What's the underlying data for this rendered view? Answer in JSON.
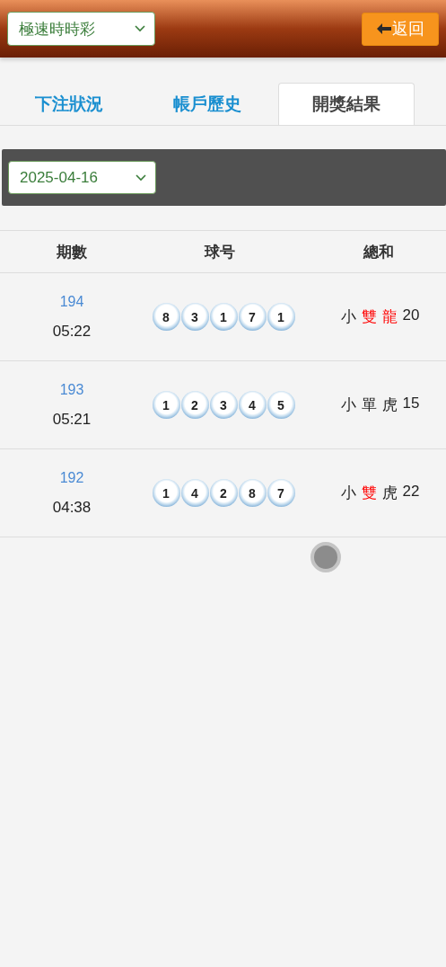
{
  "header": {
    "game_select": {
      "value": "極速時時彩"
    },
    "back_button": {
      "label": "返回"
    }
  },
  "tabs": [
    {
      "label": "下注狀況",
      "selected": false
    },
    {
      "label": "帳戶歷史",
      "selected": false
    },
    {
      "label": "開獎結果",
      "selected": true
    }
  ],
  "date_select": {
    "value": "2025-04-16"
  },
  "table": {
    "columns": [
      "期數",
      "球号",
      "總和"
    ],
    "rows": [
      {
        "issue": "194",
        "time": "05:22",
        "balls": [
          "8",
          "3",
          "1",
          "7",
          "1"
        ],
        "summary": [
          {
            "text": "小",
            "color": "#222222"
          },
          {
            "text": "雙",
            "color": "#ff0000"
          },
          {
            "text": "龍",
            "color": "#ff0000"
          }
        ],
        "total": "20"
      },
      {
        "issue": "193",
        "time": "05:21",
        "balls": [
          "1",
          "2",
          "3",
          "4",
          "5"
        ],
        "summary": [
          {
            "text": "小",
            "color": "#222222"
          },
          {
            "text": "單",
            "color": "#222222"
          },
          {
            "text": "虎",
            "color": "#222222"
          }
        ],
        "total": "15"
      },
      {
        "issue": "192",
        "time": "04:38",
        "balls": [
          "1",
          "4",
          "2",
          "8",
          "7"
        ],
        "summary": [
          {
            "text": "小",
            "color": "#222222"
          },
          {
            "text": "雙",
            "color": "#ff0000"
          },
          {
            "text": "虎",
            "color": "#222222"
          }
        ],
        "total": "22"
      }
    ]
  },
  "loading": {
    "kind": "dot"
  }
}
